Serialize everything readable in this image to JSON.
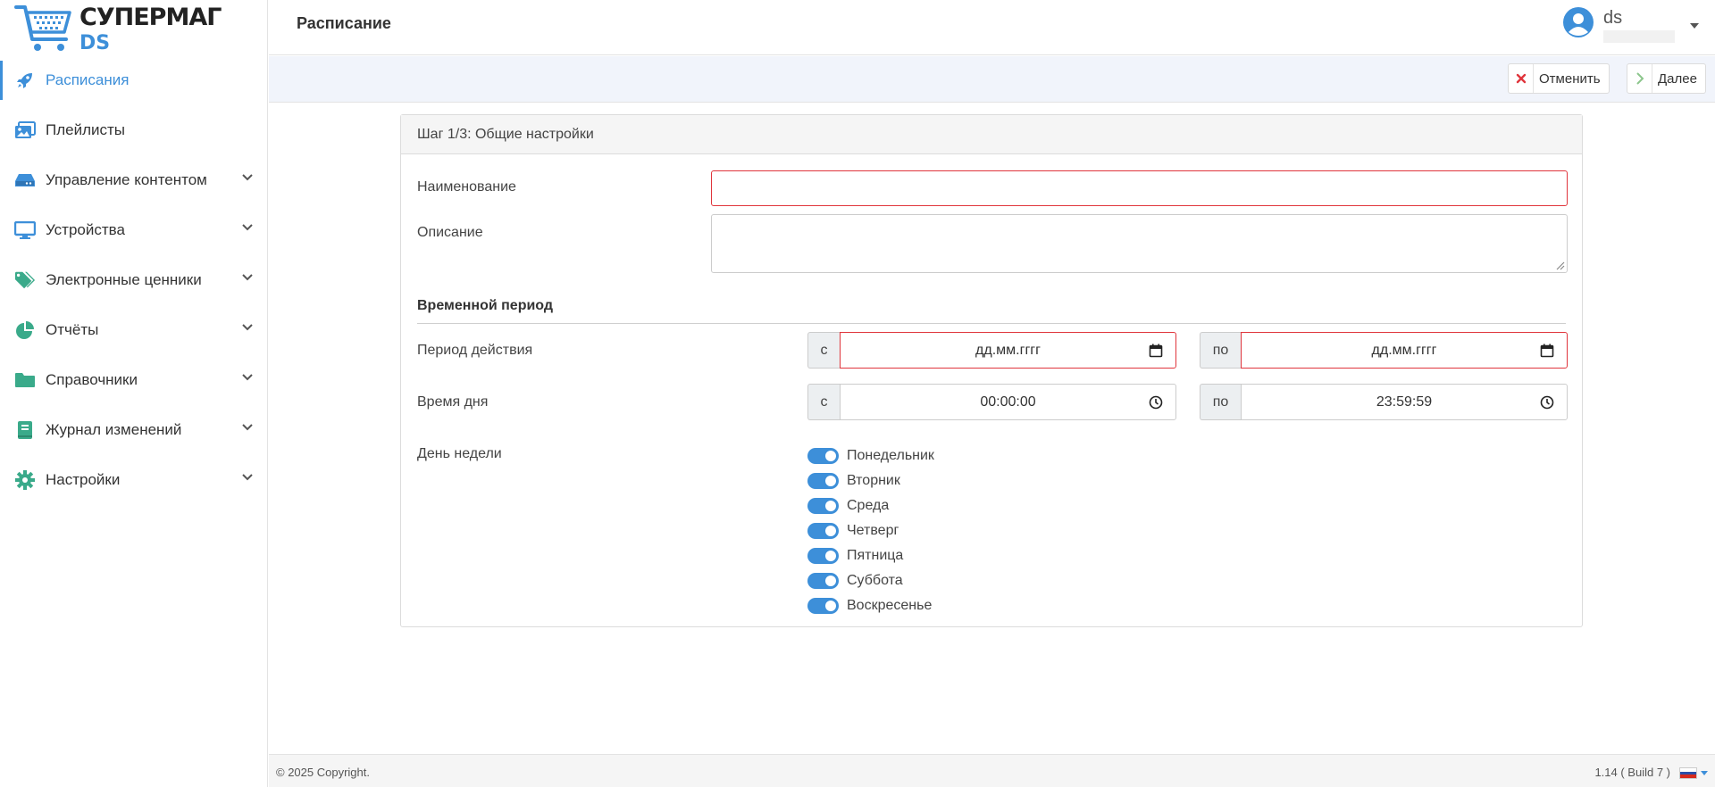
{
  "app": {
    "brand": "СУПЕРМАГ",
    "brand_sub": "DS",
    "colors": {
      "accent": "#3d8fd9",
      "error": "#e0353c",
      "nav_icon": "#3aaa8a"
    }
  },
  "sidebar": {
    "items": [
      {
        "label": "Расписания",
        "icon": "rocket-icon",
        "active": true
      },
      {
        "label": "Плейлисты",
        "icon": "images-icon"
      },
      {
        "label": "Управление контентом",
        "icon": "hdd-icon"
      },
      {
        "label": "Устройства",
        "icon": "monitor-icon"
      },
      {
        "label": "Электронные ценники",
        "icon": "tags-icon"
      },
      {
        "label": "Отчёты",
        "icon": "pie-chart-icon"
      },
      {
        "label": "Справочники",
        "icon": "folder-icon"
      },
      {
        "label": "Журнал изменений",
        "icon": "book-icon"
      },
      {
        "label": "Настройки",
        "icon": "gear-icon"
      }
    ]
  },
  "header": {
    "title": "Расписание",
    "user": {
      "name": "ds"
    }
  },
  "toolbar": {
    "cancel_label": "Отменить",
    "next_label": "Далее"
  },
  "form": {
    "step_title": "Шаг 1/3: Общие настройки",
    "name_label": "Наименование",
    "name_value": "",
    "description_label": "Описание",
    "description_value": "",
    "period_section": "Временной период",
    "validity_label": "Период действия",
    "validity_from_prefix": "с",
    "validity_from": "дд.мм.гггг",
    "validity_to_prefix": "по",
    "validity_to": "дд.мм.гггг",
    "time_label": "Время дня",
    "time_from_prefix": "с",
    "time_from": "00:00:00",
    "time_to_prefix": "по",
    "time_to": "23:59:59",
    "weekday_label": "День недели",
    "weekdays": [
      {
        "label": "Понедельник",
        "on": true
      },
      {
        "label": "Вторник",
        "on": true
      },
      {
        "label": "Среда",
        "on": true
      },
      {
        "label": "Четверг",
        "on": true
      },
      {
        "label": "Пятница",
        "on": true
      },
      {
        "label": "Суббота",
        "on": true
      },
      {
        "label": "Воскресенье",
        "on": true
      }
    ]
  },
  "footer": {
    "copyright": "© 2025 Copyright.",
    "version": "1.14 ( Build 7 )",
    "language": "ru-flag-icon"
  }
}
